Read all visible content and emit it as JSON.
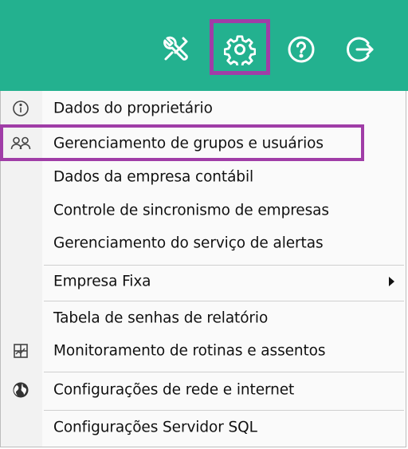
{
  "toolbar": {
    "icons": [
      {
        "name": "tools-icon"
      },
      {
        "name": "gear-icon"
      },
      {
        "name": "help-icon"
      },
      {
        "name": "logout-icon"
      }
    ]
  },
  "menu": {
    "items": [
      {
        "label": "Dados do proprietário",
        "icon": "info-icon"
      },
      {
        "label": "Gerenciamento de grupos e usuários",
        "icon": "users-icon"
      },
      {
        "label": "Dados da empresa contábil",
        "icon": ""
      },
      {
        "label": "Controle de sincronismo de empresas",
        "icon": ""
      },
      {
        "label": "Gerenciamento do serviço de alertas",
        "icon": ""
      },
      {
        "label": "Empresa Fixa",
        "icon": "",
        "submenu": true
      },
      {
        "label": "Tabela de senhas de relatório",
        "icon": ""
      },
      {
        "label": "Monitoramento de rotinas e assentos",
        "icon": "monitor-icon"
      },
      {
        "label": "Configurações de rede e internet",
        "icon": "globe-icon"
      },
      {
        "label": "Configurações Servidor SQL",
        "icon": ""
      }
    ]
  },
  "colors": {
    "toolbar_bg": "#23b18f",
    "highlight": "#a03da7"
  }
}
